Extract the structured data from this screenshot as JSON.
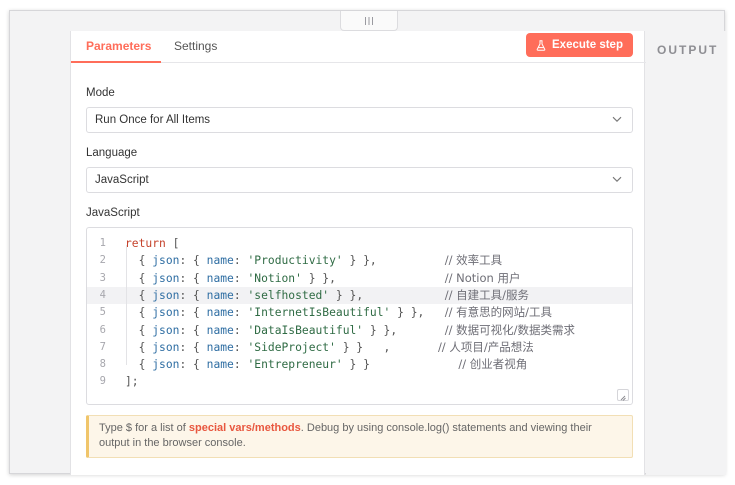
{
  "tabs": {
    "parameters": "Parameters",
    "settings": "Settings"
  },
  "execute_button": {
    "label": "Execute step",
    "icon": "flask-icon"
  },
  "output_title": "OUTPUT",
  "mode": {
    "label": "Mode",
    "value": "Run Once for All Items"
  },
  "language": {
    "label": "Language",
    "value": "JavaScript"
  },
  "code_label": "JavaScript",
  "code": {
    "lines": [
      {
        "n": "1",
        "parts": [
          [
            "kw",
            "return"
          ],
          [
            "punc",
            " ["
          ]
        ]
      },
      {
        "n": "2",
        "parts": [
          [
            "punc",
            "  { "
          ],
          [
            "key",
            "json"
          ],
          [
            "punc",
            ": { "
          ],
          [
            "key",
            "name"
          ],
          [
            "punc",
            ": "
          ],
          [
            "str",
            "'Productivity'"
          ],
          [
            "punc",
            " } },          "
          ],
          [
            "cmt",
            "// 效率工具"
          ]
        ]
      },
      {
        "n": "3",
        "parts": [
          [
            "punc",
            "  { "
          ],
          [
            "key",
            "json"
          ],
          [
            "punc",
            ": { "
          ],
          [
            "key",
            "name"
          ],
          [
            "punc",
            ": "
          ],
          [
            "str",
            "'Notion'"
          ],
          [
            "punc",
            " } },                "
          ],
          [
            "cmt",
            "// Notion 用户"
          ]
        ]
      },
      {
        "n": "4",
        "parts": [
          [
            "punc",
            "  { "
          ],
          [
            "key",
            "json"
          ],
          [
            "punc",
            ": { "
          ],
          [
            "key",
            "name"
          ],
          [
            "punc",
            ": "
          ],
          [
            "str",
            "'selfhosted'"
          ],
          [
            "punc",
            " } },            "
          ],
          [
            "cmt",
            "// 自建工具/服务"
          ]
        ]
      },
      {
        "n": "5",
        "parts": [
          [
            "punc",
            "  { "
          ],
          [
            "key",
            "json"
          ],
          [
            "punc",
            ": { "
          ],
          [
            "key",
            "name"
          ],
          [
            "punc",
            ": "
          ],
          [
            "str",
            "'InternetIsBeautiful'"
          ],
          [
            "punc",
            " } },   "
          ],
          [
            "cmt",
            "// 有意思的网站/工具"
          ]
        ]
      },
      {
        "n": "6",
        "parts": [
          [
            "punc",
            "  { "
          ],
          [
            "key",
            "json"
          ],
          [
            "punc",
            ": { "
          ],
          [
            "key",
            "name"
          ],
          [
            "punc",
            ": "
          ],
          [
            "str",
            "'DataIsBeautiful'"
          ],
          [
            "punc",
            " } },       "
          ],
          [
            "cmt",
            "// 数据可视化/数据类需求"
          ]
        ]
      },
      {
        "n": "7",
        "parts": [
          [
            "punc",
            "  { "
          ],
          [
            "key",
            "json"
          ],
          [
            "punc",
            ": { "
          ],
          [
            "key",
            "name"
          ],
          [
            "punc",
            ": "
          ],
          [
            "str",
            "'SideProject'"
          ],
          [
            "punc",
            " } }   ,       "
          ],
          [
            "cmt",
            "// 人项目/产品想法"
          ]
        ]
      },
      {
        "n": "8",
        "parts": [
          [
            "punc",
            "  { "
          ],
          [
            "key",
            "json"
          ],
          [
            "punc",
            ": { "
          ],
          [
            "key",
            "name"
          ],
          [
            "punc",
            ": "
          ],
          [
            "str",
            "'Entrepreneur'"
          ],
          [
            "punc",
            " } }             "
          ],
          [
            "cmt",
            "// 创业者视角"
          ]
        ]
      },
      {
        "n": "9",
        "parts": [
          [
            "punc",
            "];"
          ]
        ]
      }
    ],
    "active_line": 4
  },
  "hint": {
    "prefix": "Type $ for a list of ",
    "link": "special vars/methods",
    "suffix": ". Debug by using console.log() statements and viewing their output in the browser console."
  },
  "colors": {
    "accent": "#ff6d5a",
    "hint_bg": "#fdf6e9"
  }
}
